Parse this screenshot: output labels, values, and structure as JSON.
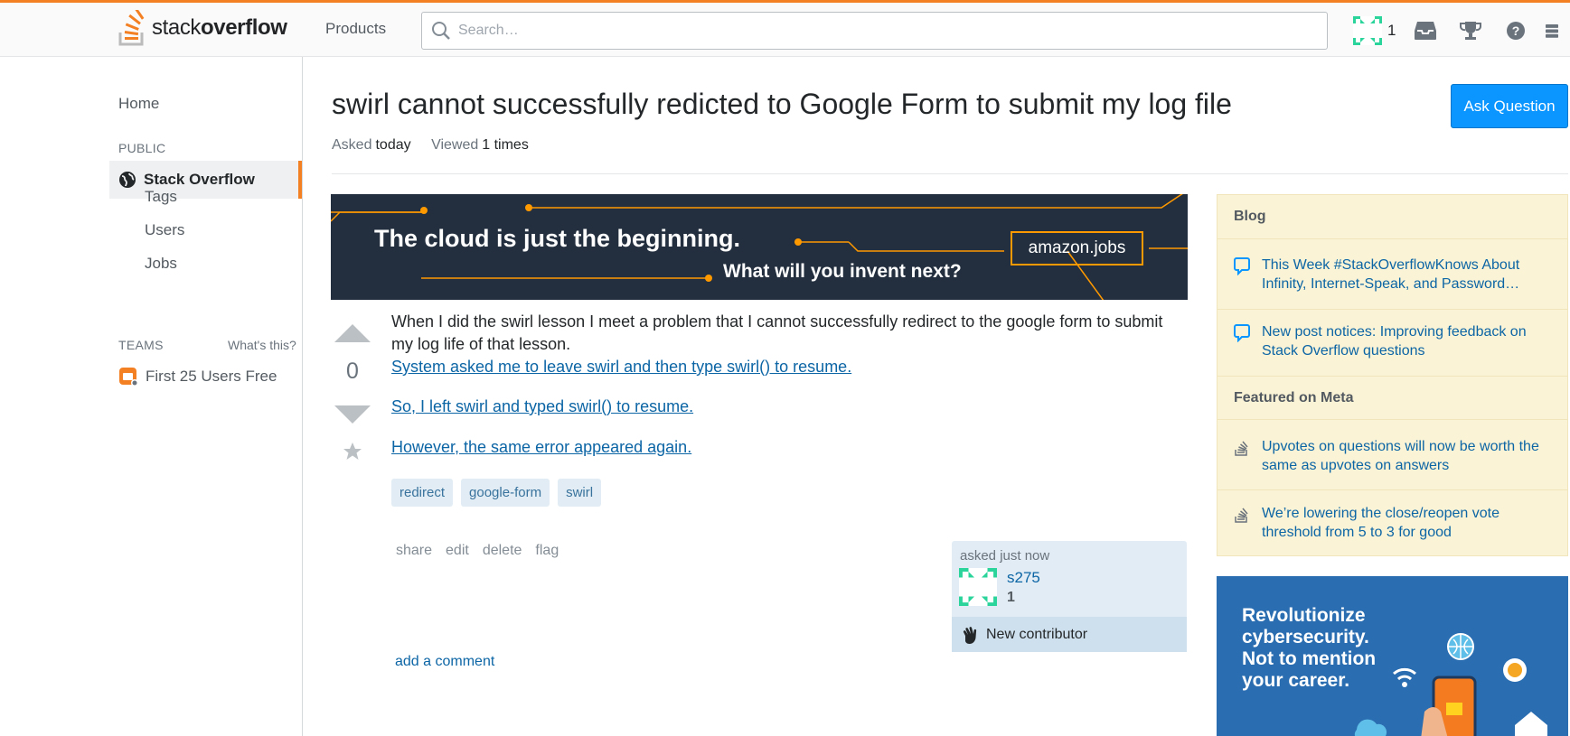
{
  "header": {
    "logo_text_light": "stack",
    "logo_text_bold": "overflow",
    "products_label": "Products",
    "search_placeholder": "Search…",
    "reputation": "1"
  },
  "leftnav": {
    "home": "Home",
    "public_heading": "PUBLIC",
    "stack_overflow": "Stack Overflow",
    "tags": "Tags",
    "users": "Users",
    "jobs": "Jobs",
    "teams_heading": "TEAMS",
    "whats_this": "What's this?",
    "team_item": "First 25 Users Free"
  },
  "question": {
    "title": "swirl cannot successfully redicted to Google Form to submit my log file",
    "asked_label": "Asked",
    "asked_value": "today",
    "viewed_label": "Viewed",
    "viewed_value": "1 times",
    "ask_button": "Ask Question",
    "vote_count": "0",
    "body_text": "When I did the swirl lesson I meet a problem that I cannot successfully redirect to the google form to submit my log life of that lesson.",
    "links": [
      "System asked me to leave swirl and then type swirl() to resume.",
      "So, I left swirl and typed swirl() to resume.",
      "However, the same error appeared again."
    ],
    "tags": [
      "redirect",
      "google-form",
      "swirl"
    ],
    "menu": [
      "share",
      "edit",
      "delete",
      "flag"
    ],
    "owner": {
      "asked": "asked just now",
      "name": "s275",
      "rep": "1",
      "new_contributor": "New contributor"
    },
    "add_comment": "add a comment"
  },
  "banner": {
    "line1": "The cloud is just the beginning.",
    "line2": "What will you invent next?",
    "brand": "amazon.jobs"
  },
  "sidebar": {
    "blog_heading": "Blog",
    "blog_items": [
      "This Week #StackOverflowKnows About Infinity, Internet-Speak, and Password…",
      "New post notices: Improving feedback on Stack Overflow questions"
    ],
    "meta_heading": "Featured on Meta",
    "meta_items": [
      "Upvotes on questions will now be worth the same as upvotes on answers",
      "We’re lowering the close/reopen vote threshold from 5 to 3 for good"
    ]
  },
  "ad2": {
    "line1": "Revolutionize",
    "line2": "cybersecurity.",
    "line3": "Not to mention",
    "line4": "your career."
  },
  "colors": {
    "accent": "#f48024",
    "link": "#0c65a5",
    "button": "#0a95ff",
    "tag_bg": "#e1ecf4",
    "sidebar_bg": "#fbf3d5"
  }
}
